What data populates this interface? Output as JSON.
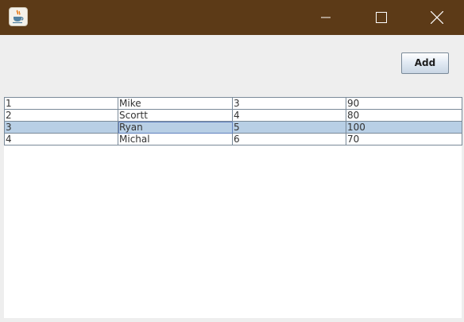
{
  "window": {
    "icon": "java-cup-icon",
    "title_bar_color": "#5c3a17"
  },
  "toolbar": {
    "add_label": "Add"
  },
  "table": {
    "rows": [
      [
        "1",
        "Mike",
        "3",
        "90"
      ],
      [
        "2",
        "Scortt",
        "4",
        "80"
      ],
      [
        "3",
        "Ryan",
        "5",
        "100"
      ],
      [
        "4",
        "Michal",
        "6",
        "70"
      ]
    ],
    "selected_row": 3,
    "selection_color": "#b8cfe5"
  }
}
